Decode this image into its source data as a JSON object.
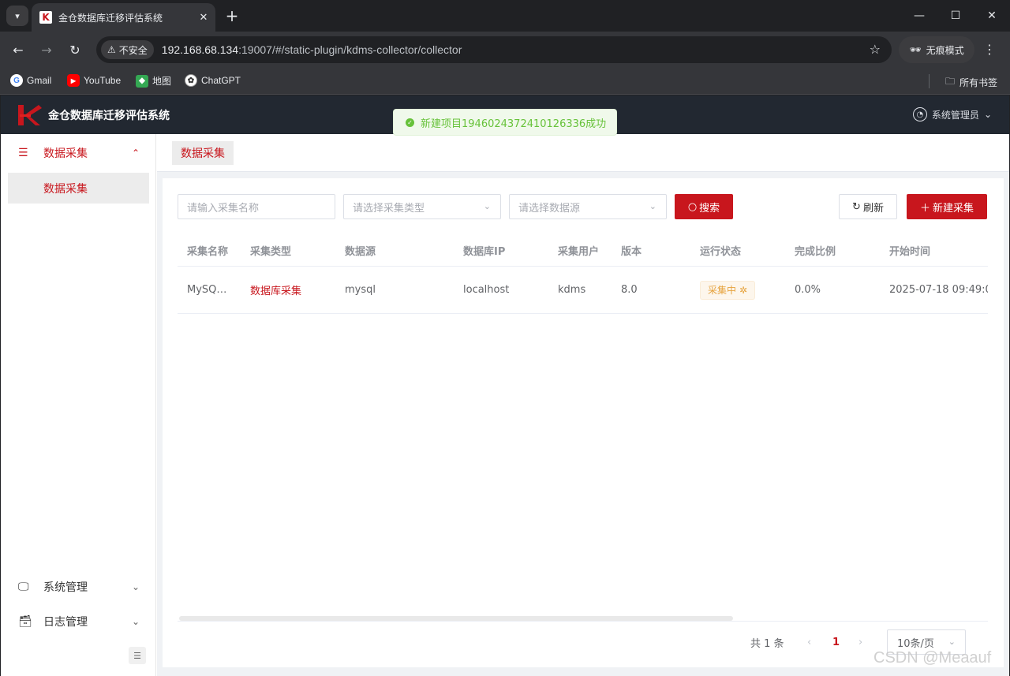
{
  "browser": {
    "tab_title": "金仓数据库迁移评估系统",
    "insecure_label": "不安全",
    "url_host": "192.168.68.134",
    "url_path": ":19007/#/static-plugin/kdms-collector/collector",
    "incognito_label": "无痕模式",
    "bookmarks": [
      {
        "label": "Gmail",
        "icon": "gmail-icon"
      },
      {
        "label": "YouTube",
        "icon": "youtube-icon"
      },
      {
        "label": "地图",
        "icon": "maps-icon"
      },
      {
        "label": "ChatGPT",
        "icon": "chatgpt-icon"
      }
    ],
    "all_bookmarks_label": "所有书签"
  },
  "app": {
    "title": "金仓数据库迁移评估系统",
    "user": "系统管理员",
    "brand_color": "#c8161d"
  },
  "toast": {
    "message": "新建项目1946024372410126336成功"
  },
  "sidebar": {
    "groups": [
      {
        "label": "数据采集",
        "icon": "list-check-icon",
        "expanded": true
      },
      {
        "label": "系统管理",
        "icon": "monitor-icon",
        "expanded": false
      },
      {
        "label": "日志管理",
        "icon": "archive-icon",
        "expanded": false
      }
    ],
    "active_item": "数据采集"
  },
  "tags": {
    "active": "数据采集"
  },
  "filters": {
    "name_placeholder": "请输入采集名称",
    "type_placeholder": "请选择采集类型",
    "source_placeholder": "请选择数据源",
    "search_label": "搜索",
    "refresh_label": "刷新",
    "new_label": "新建采集"
  },
  "table": {
    "headers": [
      "采集名称",
      "采集类型",
      "数据源",
      "数据库IP",
      "采集用户",
      "版本",
      "运行状态",
      "完成比例",
      "开始时间"
    ],
    "rows": [
      {
        "name": "MySQ…",
        "type": "数据库采集",
        "source": "mysql",
        "ip": "localhost",
        "user": "kdms",
        "version": "8.0",
        "status": "采集中",
        "progress": "0.0%",
        "start_time": "2025-07-18 09:49:0"
      }
    ]
  },
  "pagination": {
    "total_label": "共 1 条",
    "current_page": "1",
    "page_size": "10条/页"
  },
  "watermark": "CSDN @Meaauf"
}
